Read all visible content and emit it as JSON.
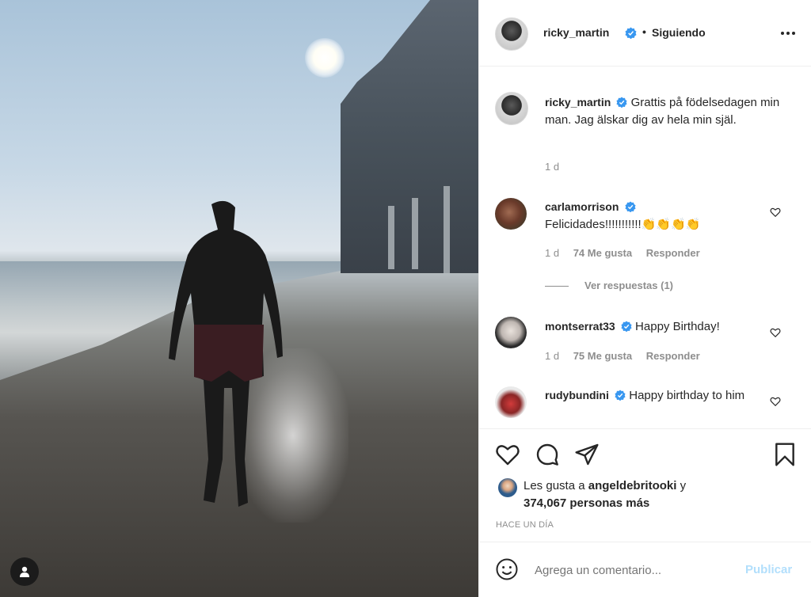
{
  "post": {
    "username": "ricky_martin",
    "follow_separator": "•",
    "follow_status": "Siguiendo",
    "more_icon": "more-horizontal-icon"
  },
  "caption": {
    "username": "ricky_martin",
    "text": "Grattis på födelsedagen min man. Jag älskar dig av hela min själ.",
    "time": "1 d"
  },
  "comments": [
    {
      "username": "carlamorrison",
      "verified": true,
      "text": "Felicidades!!!!!!!!!!!👏👏👏👏",
      "time": "1 d",
      "likes": "74 Me gusta",
      "reply": "Responder",
      "replies_label": "Ver respuestas (1)"
    },
    {
      "username": "montserrat33",
      "verified": true,
      "text": "Happy Birthday!",
      "time": "1 d",
      "likes": "75 Me gusta",
      "reply": "Responder"
    },
    {
      "username": "rudybundini",
      "verified": true,
      "text": "Happy birthday to him"
    }
  ],
  "likes": {
    "prefix": "Les gusta a",
    "liker": "angeldebritooki",
    "conjunction": "y",
    "others": "374,067 personas más"
  },
  "timestamp": "HACE UN DÍA",
  "comment_input": {
    "placeholder": "Agrega un comentario...",
    "publish_label": "Publicar",
    "publish_color": "#b2dffc"
  },
  "colors": {
    "verified": "#3897f0",
    "muted": "#8e8e8e",
    "text": "#262626"
  }
}
